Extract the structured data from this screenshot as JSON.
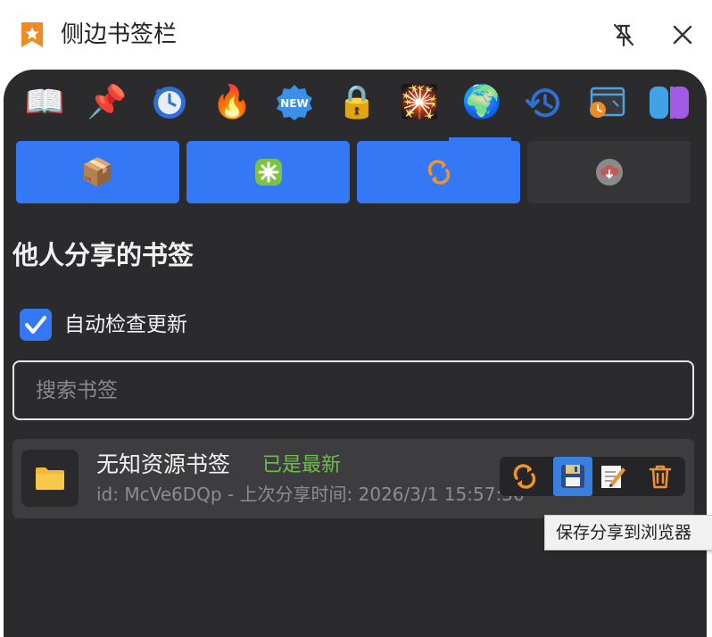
{
  "window": {
    "title": "侧边书签栏",
    "icons": {
      "app": "bookmark-star-icon",
      "pin": "pin-off-icon",
      "close": "close-icon"
    }
  },
  "icon_bar": [
    {
      "name": "open-book-icon",
      "glyph": "📖"
    },
    {
      "name": "pushpin-icon",
      "glyph": "📌"
    },
    {
      "name": "clock-refresh-icon",
      "glyph": "⏲"
    },
    {
      "name": "fire-icon",
      "glyph": "🔥"
    },
    {
      "name": "new-badge-icon",
      "glyph": "🆕"
    },
    {
      "name": "lock-icon",
      "glyph": "🔒"
    },
    {
      "name": "sparkler-icon",
      "glyph": "🎇"
    },
    {
      "name": "globe-icon",
      "glyph": "🌍"
    },
    {
      "name": "history-clock-icon",
      "glyph": "🕘"
    },
    {
      "name": "browser-clock-icon",
      "glyph": "🗔"
    },
    {
      "name": "toggle-switch-icon",
      "glyph": "◨"
    }
  ],
  "tabs": [
    {
      "name": "package-icon",
      "glyph": "📦",
      "active": true
    },
    {
      "name": "sparkle-icon",
      "glyph": "✳",
      "active": true
    },
    {
      "name": "sync-icon",
      "glyph": "🔄",
      "active": true
    },
    {
      "name": "cloud-download-icon",
      "glyph": "☁",
      "active": false
    }
  ],
  "section_title": "他人分享的书签",
  "auto_check": {
    "label": "自动检查更新",
    "checked": true
  },
  "search": {
    "placeholder": "搜索书签",
    "value": ""
  },
  "shared_items": [
    {
      "title": "无知资源书签",
      "status": "已是最新",
      "meta": "id: McVe6DQp - 上次分享时间: 2026/3/1 15:57:36",
      "actions": [
        "sync-icon",
        "save-floppy-icon",
        "edit-memo-icon",
        "trash-icon"
      ]
    }
  ],
  "tooltip": "保存分享到浏览器",
  "colors": {
    "accent": "#3478f6",
    "panel": "#2b2b2d",
    "status_green": "#6cc04a",
    "action_orange": "#f0922e"
  }
}
